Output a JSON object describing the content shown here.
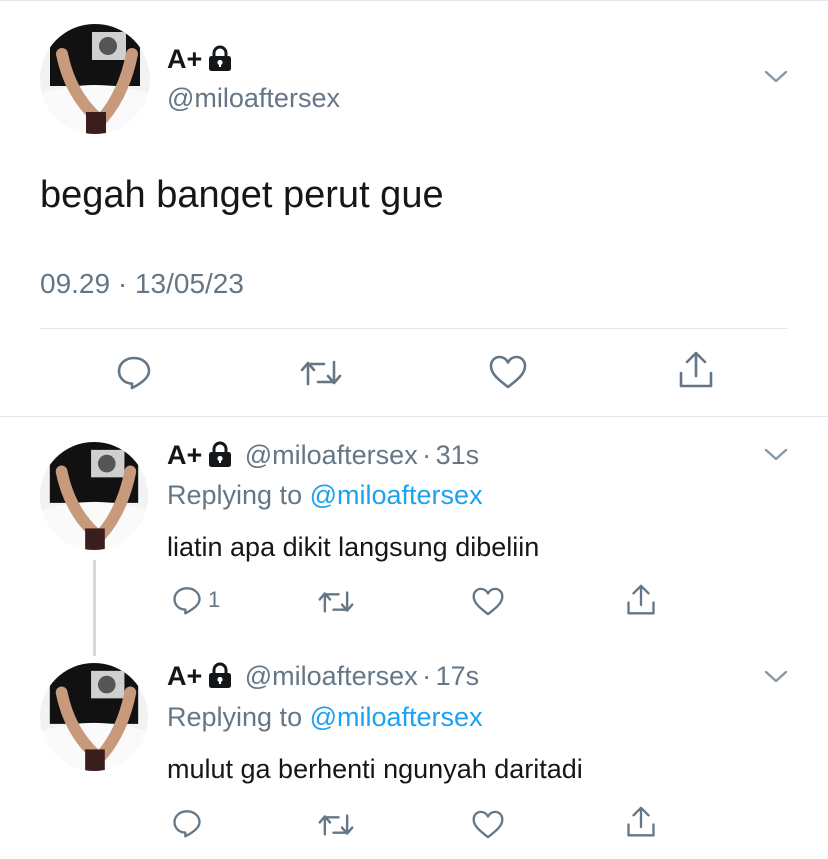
{
  "colors": {
    "text": "#14171a",
    "muted": "#657786",
    "link": "#1da1f2",
    "divider": "#e1e8ed"
  },
  "main_tweet": {
    "display_name": "A+",
    "handle": "@miloaftersex",
    "text": "begah banget perut gue",
    "timestamp": "09.29 · 13/05/23",
    "actions": [
      "reply-icon",
      "retweet-icon",
      "like-icon",
      "share-icon"
    ]
  },
  "replies": [
    {
      "display_name": "A+",
      "handle": "@miloaftersex",
      "separator": "·",
      "time": "31s",
      "replying_prefix": "Replying to",
      "replying_handle": "@miloaftersex",
      "text": "liatin apa dikit langsung dibeliin",
      "reply_count": "1"
    },
    {
      "display_name": "A+",
      "handle": "@miloaftersex",
      "separator": "·",
      "time": "17s",
      "replying_prefix": "Replying to",
      "replying_handle": "@miloaftersex",
      "text": "mulut ga berhenti ngunyah daritadi",
      "reply_count": ""
    }
  ]
}
